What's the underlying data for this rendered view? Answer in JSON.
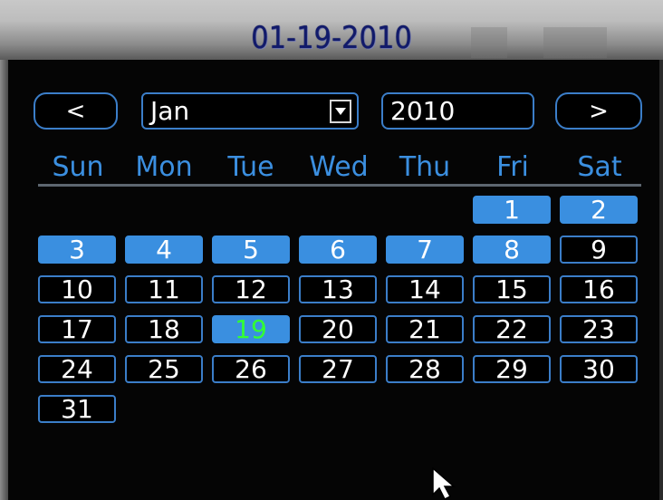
{
  "window": {
    "title": "01-19-2010"
  },
  "nav": {
    "prev_label": "<",
    "next_label": ">"
  },
  "month_select": {
    "value": "Jan"
  },
  "year_field": {
    "value": "2010"
  },
  "weekdays": [
    "Sun",
    "Mon",
    "Tue",
    "Wed",
    "Thu",
    "Fri",
    "Sat"
  ],
  "days": [
    "1",
    "2",
    "3",
    "4",
    "5",
    "6",
    "7",
    "8",
    "9",
    "10",
    "11",
    "12",
    "13",
    "14",
    "15",
    "16",
    "17",
    "18",
    "19",
    "20",
    "21",
    "22",
    "23",
    "24",
    "25",
    "26",
    "27",
    "28",
    "29",
    "30",
    "31"
  ],
  "recorded_days": [
    "1",
    "2",
    "3",
    "4",
    "5",
    "6",
    "7",
    "8"
  ],
  "selected_day": "19",
  "colors": {
    "accent": "#3a8fe0",
    "today_text": "#33ff33",
    "title_text": "#111a6b"
  },
  "icons": {
    "dropdown": "chevron-down-icon",
    "pointer": "mouse-cursor-icon"
  }
}
